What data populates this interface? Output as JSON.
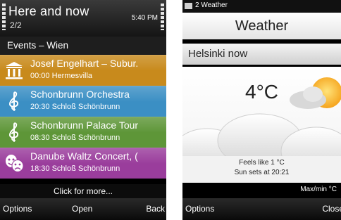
{
  "left_phone": {
    "app_title": "Here and now",
    "page_count": "2/2",
    "clock": "5:40 PM",
    "section_header": "Events – Wien",
    "events": [
      {
        "title": "Josef Engelhart – Subur.",
        "subtitle": "00:00 Hermesvilla",
        "color": "#c88a1c",
        "icon": "museum-columns-icon"
      },
      {
        "title": "Schonbrunn Orchestra",
        "subtitle": "20:30 Schloß Schönbrunn",
        "color": "#3b8fc4",
        "icon": "treble-clef-icon"
      },
      {
        "title": "Schonbrunn Palace Tour",
        "subtitle": "08:30 Schloß Schönbrunn",
        "color": "#5e9638",
        "icon": "treble-clef-icon"
      },
      {
        "title": "Danube Waltz Concert, (",
        "subtitle": "18:30 Schloß Schönbrunn",
        "color": "#9a3d9c",
        "icon": "theater-masks-icon"
      }
    ],
    "click_more": "Click for more...",
    "softkeys": {
      "left": "Options",
      "center": "Open",
      "right": "Back"
    }
  },
  "right_phone": {
    "status_text": "2 Weather",
    "header_title": "Weather",
    "location": "Helsinki now",
    "temperature": "4°C",
    "condition_icon": "partly-cloudy-sun-icon",
    "feels_like": "Feels like 1 °C",
    "sunset": "Sun sets at 20:21",
    "maxmin_label": "Max/min °C",
    "progress_fraction": 0.82,
    "progress_color": "#4fa6e8",
    "softkeys": {
      "left": "Options",
      "right": "Close"
    }
  }
}
